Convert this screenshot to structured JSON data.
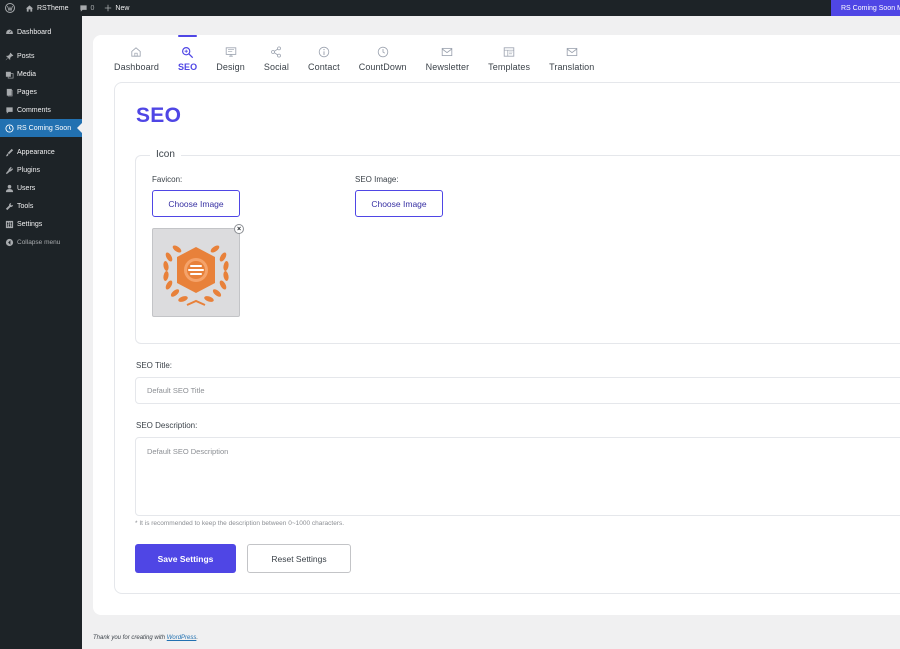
{
  "adminbar": {
    "wp_logo": "wordpress-icon",
    "site_name": "RSTheme",
    "comments_count": "0",
    "new_label": "New",
    "right_label": "RS Coming Soon Mode Active"
  },
  "sidebar": {
    "items": [
      {
        "label": "Dashboard",
        "icon": "dashboard-icon"
      },
      {
        "label": "Posts",
        "icon": "pin-icon"
      },
      {
        "label": "Media",
        "icon": "media-icon"
      },
      {
        "label": "Pages",
        "icon": "page-icon"
      },
      {
        "label": "Comments",
        "icon": "comment-icon"
      },
      {
        "label": "RS Coming Soon",
        "icon": "clock-icon",
        "active": true
      },
      {
        "label": "Appearance",
        "icon": "brush-icon"
      },
      {
        "label": "Plugins",
        "icon": "plugin-icon"
      },
      {
        "label": "Users",
        "icon": "user-icon"
      },
      {
        "label": "Tools",
        "icon": "wrench-icon"
      },
      {
        "label": "Settings",
        "icon": "settings-icon"
      }
    ],
    "collapse_label": "Collapse menu"
  },
  "tabs": [
    {
      "label": "Dashboard",
      "icon": "home-icon"
    },
    {
      "label": "SEO",
      "icon": "seo-icon",
      "active": true
    },
    {
      "label": "Design",
      "icon": "design-icon"
    },
    {
      "label": "Social",
      "icon": "share-icon"
    },
    {
      "label": "Contact",
      "icon": "info-icon"
    },
    {
      "label": "CountDown",
      "icon": "clock-icon"
    },
    {
      "label": "Newsletter",
      "icon": "mail-icon"
    },
    {
      "label": "Templates",
      "icon": "template-icon"
    },
    {
      "label": "Translation",
      "icon": "mail-icon"
    }
  ],
  "page": {
    "title": "SEO",
    "icon_legend": "Icon",
    "favicon_label": "Favicon:",
    "seo_image_label": "SEO Image:",
    "choose_image": "Choose Image",
    "remove_symbol": "×",
    "seo_title_label": "SEO Title:",
    "seo_title_placeholder": "Default SEO Title",
    "seo_desc_label": "SEO Description:",
    "seo_desc_placeholder": "Default SEO Description",
    "hint": "* It is recommended to keep the description between 0~1000 characters.",
    "save_label": "Save Settings",
    "reset_label": "Reset Settings"
  },
  "footer": {
    "text": "Thank you for creating with",
    "link": "WordPress",
    "suffix": "."
  },
  "colors": {
    "accent": "#4f46e5",
    "admin_dark": "#1d2327",
    "wp_blue": "#2271b1",
    "favicon_orange": "#e8813a"
  }
}
